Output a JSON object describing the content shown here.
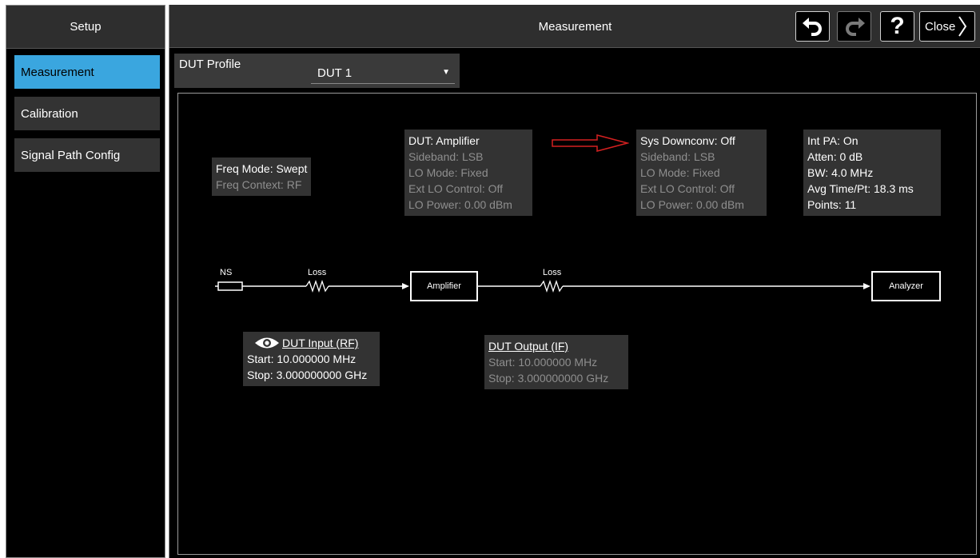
{
  "sidebar": {
    "header": "Setup",
    "items": [
      {
        "label": "Measurement",
        "active": true
      },
      {
        "label": "Calibration",
        "active": false
      },
      {
        "label": "Signal Path Config",
        "active": false
      }
    ]
  },
  "header": {
    "title": "Measurement",
    "buttons": {
      "undo_icon": "undo-icon",
      "redo_icon": "redo-icon",
      "help": "?",
      "close": "Close"
    }
  },
  "dut_profile": {
    "label": "DUT Profile",
    "selected": "DUT 1"
  },
  "diagram": {
    "freq": {
      "mode": "Freq Mode: Swept",
      "context": "Freq Context: RF"
    },
    "dut": {
      "title": "DUT: Amplifier",
      "sideband": "Sideband: LSB",
      "lo_mode": "LO Mode: Fixed",
      "ext_lo": "Ext LO Control: Off",
      "lo_power": "LO Power: 0.00 dBm"
    },
    "sys": {
      "title": "Sys Downconv: Off",
      "sideband": "Sideband: LSB",
      "lo_mode": "LO Mode: Fixed",
      "ext_lo": "Ext LO Control: Off",
      "lo_power": "LO Power: 0.00 dBm"
    },
    "analyzer_info": {
      "int_pa": "Int PA: On",
      "atten": "Atten: 0 dB",
      "bw": "BW: 4.0 MHz",
      "avg_time": "Avg Time/Pt: 18.3 ms",
      "points": "Points: 11"
    },
    "path": {
      "ns": "NS",
      "loss1": "Loss",
      "amplifier": "Amplifier",
      "loss2": "Loss",
      "analyzer": "Analyzer"
    },
    "dut_input": {
      "title": "DUT Input (RF)",
      "start": "Start: 10.000000 MHz",
      "stop": "Stop: 3.000000000 GHz"
    },
    "dut_output": {
      "title": "DUT Output (IF)",
      "start": "Start: 10.000000 MHz",
      "stop": "Stop: 3.000000000 GHz"
    }
  },
  "colors": {
    "active": "#3aa6df",
    "arrow": "#d42020"
  }
}
